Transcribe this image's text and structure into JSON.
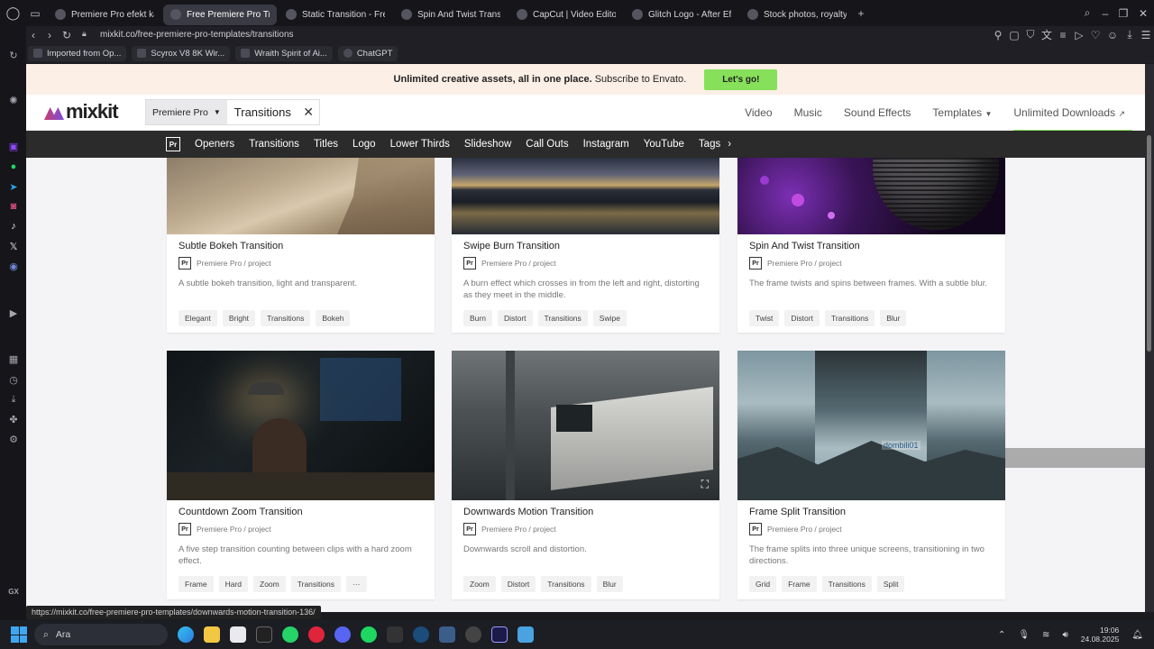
{
  "browser": {
    "tabs": [
      {
        "label": "Premiere Pro efekt kaynak",
        "icon": "web-icon",
        "active": false
      },
      {
        "label": "Free Premiere Pro Transit",
        "icon": "mixkit-icon",
        "active": true
      },
      {
        "label": "Static Transition - Free Pr",
        "icon": "mixkit-icon",
        "active": false
      },
      {
        "label": "Spin And Twist Transition",
        "icon": "mixkit-icon",
        "active": false
      },
      {
        "label": "CapCut | Video Editor | A",
        "icon": "capcut-icon",
        "active": false
      },
      {
        "label": "Glitch Logo - After Effect",
        "icon": "envato-icon",
        "active": false
      },
      {
        "label": "Stock photos, royalty-free",
        "icon": "stock-icon",
        "active": false
      }
    ],
    "new_tab": "+",
    "url": "mixkit.co/free-premiere-pro-templates/transitions",
    "bookmarks": [
      {
        "label": "Imported from Op..."
      },
      {
        "label": "Scyrox V8 8K Wir..."
      },
      {
        "label": "Wraith Spirit of Ai..."
      },
      {
        "label": "ChatGPT"
      }
    ],
    "status_url": "https://mixkit.co/free-premiere-pro-templates/downwards-motion-transition-136/"
  },
  "promo": {
    "bold_text": "Unlimited creative assets, all in one place.",
    "text": "Subscribe to Envato.",
    "cta": "Let's go!"
  },
  "header": {
    "logo_text": "mixkit",
    "search": {
      "category": "Premiere Pro",
      "query": "Transitions"
    },
    "nav": [
      "Video",
      "Music",
      "Sound Effects",
      "Templates",
      "Unlimited Downloads"
    ]
  },
  "categories": {
    "badge": "Pr",
    "items": [
      "Openers",
      "Transitions",
      "Titles",
      "Logo",
      "Lower Thirds",
      "Slideshow",
      "Call Outs",
      "Instagram",
      "YouTube",
      "Tags"
    ]
  },
  "cards": [
    {
      "title": "Subtle Bokeh Transition",
      "badge": "Pr",
      "meta": "Premiere Pro / project",
      "desc": "A subtle bokeh transition, light and transparent.",
      "tags": [
        "Elegant",
        "Bright",
        "Transitions",
        "Bokeh"
      ]
    },
    {
      "title": "Swipe Burn Transition",
      "badge": "Pr",
      "meta": "Premiere Pro / project",
      "desc": "A burn effect which crosses in from the left and right, distorting as they meet in the middle.",
      "tags": [
        "Burn",
        "Distort",
        "Transitions",
        "Swipe"
      ]
    },
    {
      "title": "Spin And Twist Transition",
      "badge": "Pr",
      "meta": "Premiere Pro / project",
      "desc": "The frame twists and spins between frames. With a subtle blur.",
      "tags": [
        "Twist",
        "Distort",
        "Transitions",
        "Blur"
      ]
    },
    {
      "title": "Countdown Zoom Transition",
      "badge": "Pr",
      "meta": "Premiere Pro / project",
      "desc": "A five step transition counting between clips with a hard zoom effect.",
      "tags": [
        "Frame",
        "Hard",
        "Zoom",
        "Transitions",
        "···"
      ]
    },
    {
      "title": "Downwards Motion Transition",
      "badge": "Pr",
      "meta": "Premiere Pro / project",
      "desc": "Downwards scroll and distortion.",
      "tags": [
        "Zoom",
        "Distort",
        "Transitions",
        "Blur"
      ]
    },
    {
      "title": "Frame Split Transition",
      "badge": "Pr",
      "meta": "Premiere Pro / project",
      "desc": "The frame splits into three unique screens, transitioning in two directions.",
      "tags": [
        "Grid",
        "Frame",
        "Transitions",
        "Split"
      ]
    }
  ],
  "thumb_overlay": {
    "watermark": "dombili01"
  },
  "taskbar": {
    "search_label": "Ara",
    "time": "19:06",
    "date": "24.08.2025"
  },
  "leftbar": {
    "gx_label": "GX"
  },
  "colors": {
    "accent_green": "#87e05a",
    "promo_bg": "#fbefe6",
    "catbar_bg": "#2b2b2b"
  }
}
